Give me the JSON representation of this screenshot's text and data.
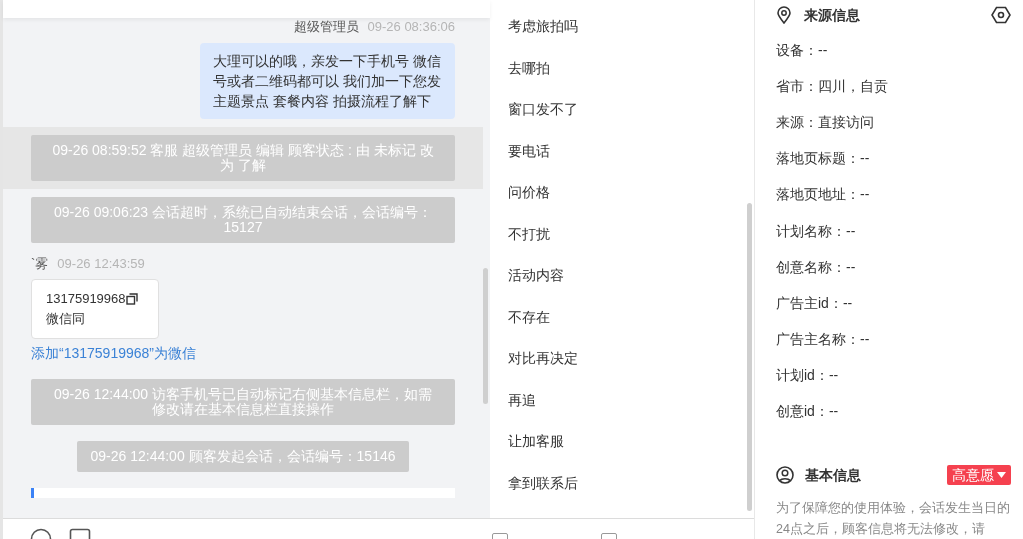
{
  "chat": {
    "messages": [
      {
        "kind": "agent",
        "sender": "超级管理员",
        "time": "09-26 08:36:06",
        "text": "大理可以的哦，亲发一下手机号 微信号或者二维码都可以 我们加一下您发主题景点 套餐内容 拍摄流程了解下"
      },
      {
        "kind": "system",
        "text": "09-26 08:59:52 客服 超级管理员 编辑 顾客状态 : 由 未标记 改为 了解",
        "selected": true
      },
      {
        "kind": "system",
        "text": "09-26 09:06:23 会话超时，系统已自动结束会话，会话编号：15127",
        "selected": false
      },
      {
        "kind": "visitor",
        "sender": "`雾",
        "time": "09-26 12:43:59",
        "lines": [
          "13175919968",
          "微信同"
        ],
        "link": "添加“13175919968”为微信"
      },
      {
        "kind": "system",
        "text": "09-26 12:44:00 访客手机号已自动标记右侧基本信息栏，如需修改请在基本信息栏直接操作",
        "selected": false
      },
      {
        "kind": "system_short",
        "text": "09-26 12:44:00 顾客发起会话，会话编号：15146",
        "selected": false
      }
    ]
  },
  "quick_replies": {
    "items": [
      "考虑旅拍吗",
      "去哪拍",
      "窗口发不了",
      "要电话",
      "问价格",
      "不打扰",
      "活动内容",
      "不存在",
      "对比再决定",
      "再追",
      "让加客服",
      "拿到联系后"
    ],
    "options": [
      {
        "checked": false
      },
      {
        "checked": false
      }
    ]
  },
  "source_info": {
    "title": "来源信息",
    "fields": [
      "设备：--",
      "省市：四川，自贡",
      "来源：直接访问",
      "落地页标题：--",
      "落地页地址：--",
      "计划名称：--",
      "创意名称：--",
      "广告主id：--",
      "广告主名称：--",
      "计划id：--",
      "创意id：--"
    ]
  },
  "basic_info": {
    "title": "基本信息",
    "tag": "高意愿",
    "note": "为了保障您的使用体验，会话发生当日的24点之后，顾客信息将无法修改，请"
  }
}
